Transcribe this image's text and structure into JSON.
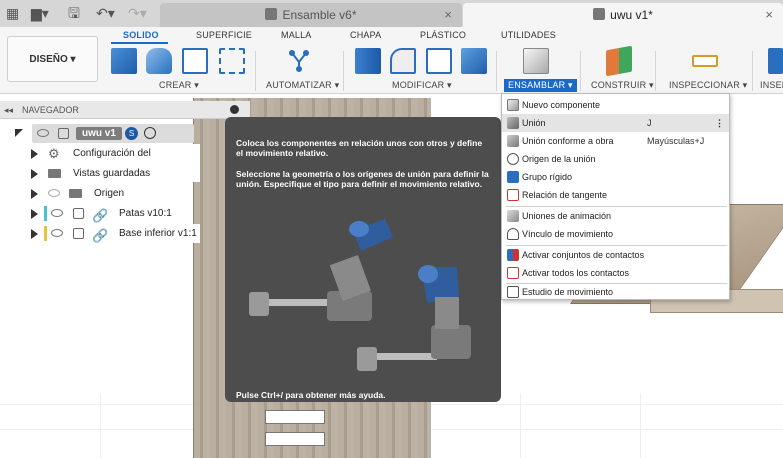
{
  "tabs": [
    {
      "label": "Ensamble v6*",
      "close": "×"
    },
    {
      "label": "uwu v1*",
      "close": "×"
    }
  ],
  "workspace": {
    "label": "DISEÑO ▾"
  },
  "ribbon_tabs": [
    "SOLIDO",
    "SUPERFICIE",
    "MALLA",
    "CHAPA",
    "PLÁSTICO",
    "UTILIDADES"
  ],
  "groups": [
    "CREAR ▾",
    "AUTOMATIZAR ▾",
    "MODIFICAR ▾",
    "ENSAMBLAR ▾",
    "CONSTRUIR ▾",
    "INSPECCIONAR ▾",
    "INSER"
  ],
  "navigator": {
    "title": "NAVEGADOR",
    "root": "uwu v1",
    "items": [
      {
        "label": "Configuración del documento",
        "icon": "gear-icon"
      },
      {
        "label": "Vistas guardadas",
        "icon": "folder-icon"
      },
      {
        "label": "Origen",
        "icon": "folder-icon"
      },
      {
        "label": "Patas v10:1",
        "icon": "link-icon"
      },
      {
        "label": "Base inferior v1:1",
        "icon": "link-icon"
      }
    ]
  },
  "tooltip": {
    "p1": "Coloca los componentes en relación unos con otros y define el movimiento relativo.",
    "p2": "Seleccione la geometría o los orígenes de unión para definir la unión. Especifique el tipo para definir el movimiento relativo.",
    "footer": "Pulse Ctrl+/ para obtener más ayuda."
  },
  "menu": {
    "items": [
      {
        "label": "Nuevo componente",
        "shortcut": ""
      },
      {
        "label": "Unión",
        "shortcut": "J"
      },
      {
        "label": "Unión conforme a obra",
        "shortcut": "Mayúsculas+J"
      },
      {
        "label": "Origen de la unión",
        "shortcut": ""
      },
      {
        "label": "Grupo rígido",
        "shortcut": ""
      },
      {
        "label": "Relación de tangente",
        "shortcut": ""
      },
      {
        "label": "Uniones de animación",
        "shortcut": ""
      },
      {
        "label": "Vínculo de movimiento",
        "shortcut": ""
      },
      {
        "label": "Activar conjuntos de contactos",
        "shortcut": ""
      },
      {
        "label": "Activar todos los contactos",
        "shortcut": ""
      },
      {
        "label": "Estudio de movimiento",
        "shortcut": ""
      }
    ],
    "more": "⋮"
  },
  "colors": {
    "accent": "#1b6ac9",
    "tooltip_bg": "#4d4d4d",
    "wood": "#b6ab9c"
  }
}
